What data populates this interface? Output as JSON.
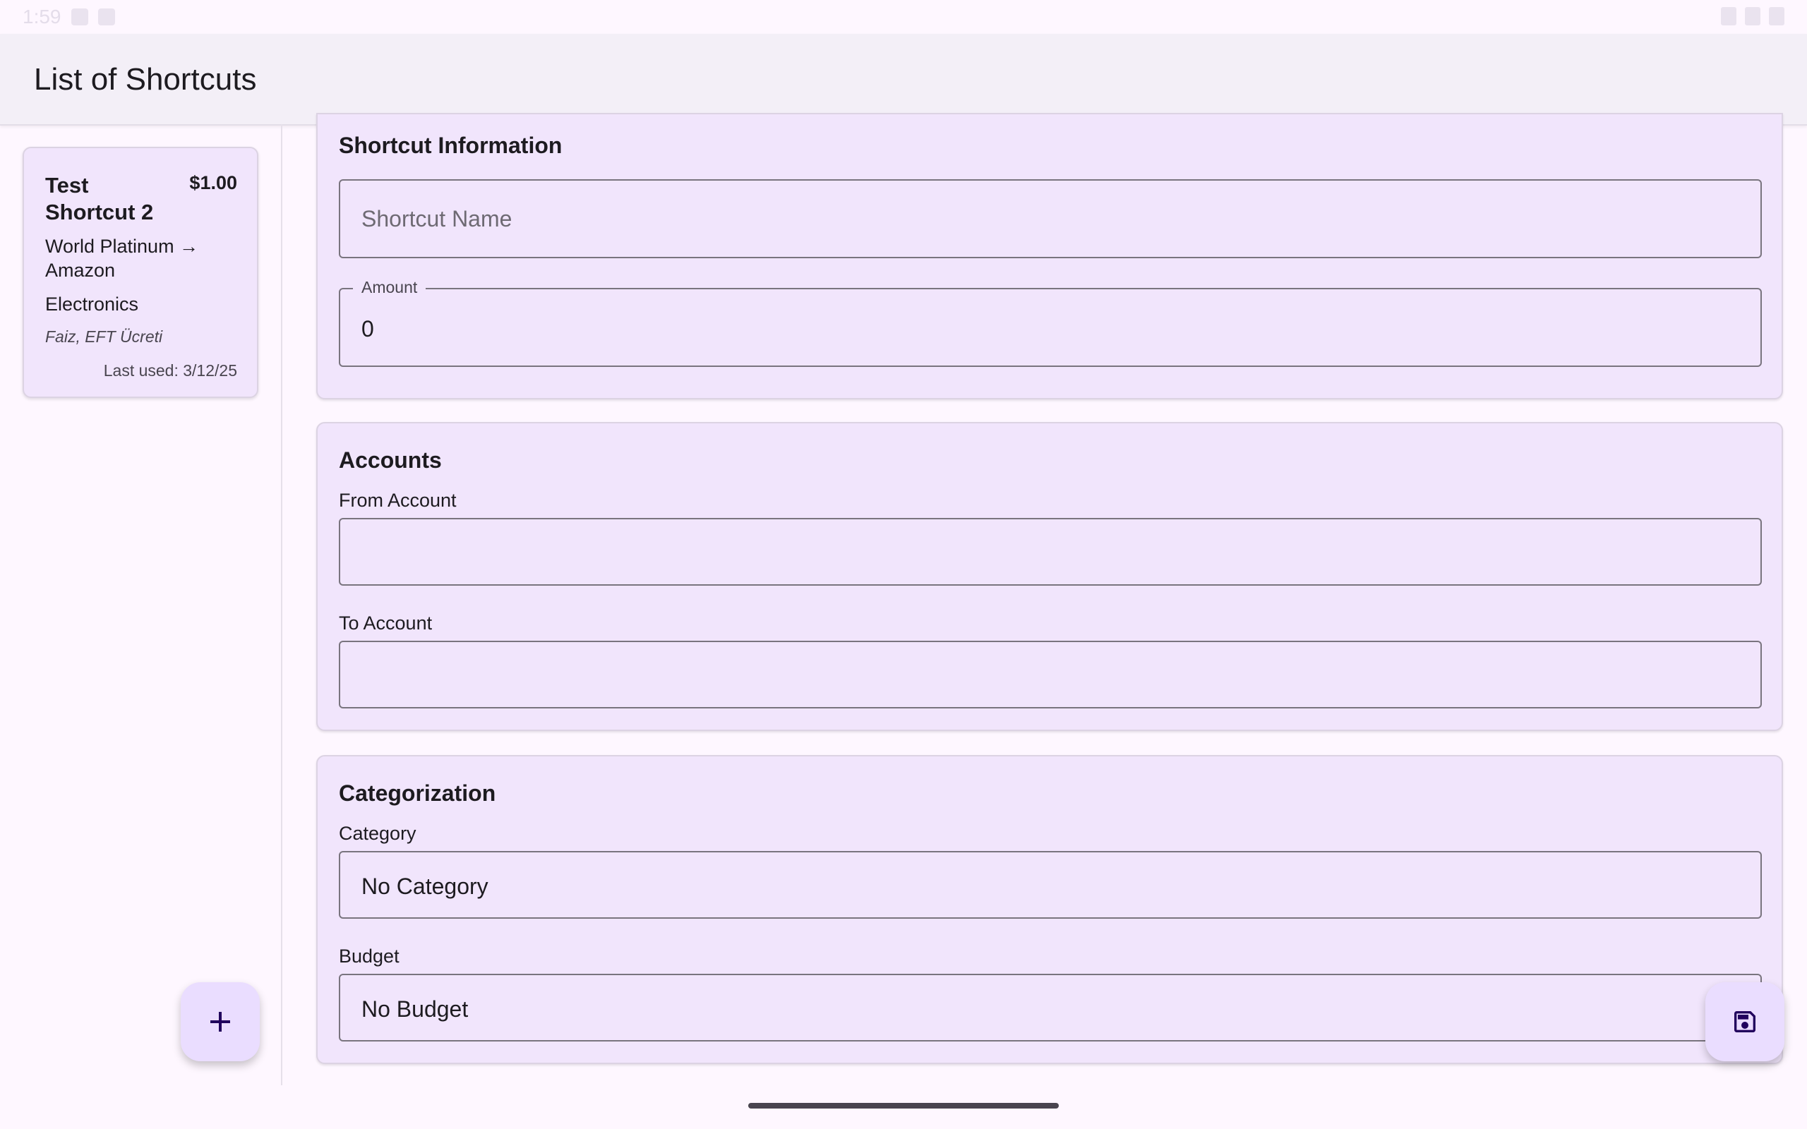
{
  "status_bar": {
    "time": "1:59",
    "right_text": ""
  },
  "app_bar": {
    "title": "List of Shortcuts"
  },
  "shortcut_list": [
    {
      "name": "Test Shortcut 2",
      "amount": "$1.00",
      "route": "World Platinum → Amazon",
      "category": "Electronics",
      "tags": "Faiz, EFT Ücreti",
      "last_used": "Last used: 3/12/25"
    }
  ],
  "sections": {
    "info": {
      "title": "Shortcut Information",
      "name_placeholder": "Shortcut Name",
      "name_value": "",
      "amount_label": "Amount",
      "amount_value": "0"
    },
    "accounts": {
      "title": "Accounts",
      "from_label": "From Account",
      "from_value": "",
      "to_label": "To Account",
      "to_value": ""
    },
    "categorization": {
      "title": "Categorization",
      "category_label": "Category",
      "category_value": "No Category",
      "budget_label": "Budget",
      "budget_value": "No Budget"
    }
  },
  "fabs": {
    "add_icon": "plus-icon",
    "save_icon": "save-icon"
  },
  "colors": {
    "background": "#FEF7FF",
    "card": "#F1E5FC",
    "fab": "#EADDFF",
    "fab_icon": "#21005D",
    "outline": "#79747E"
  }
}
